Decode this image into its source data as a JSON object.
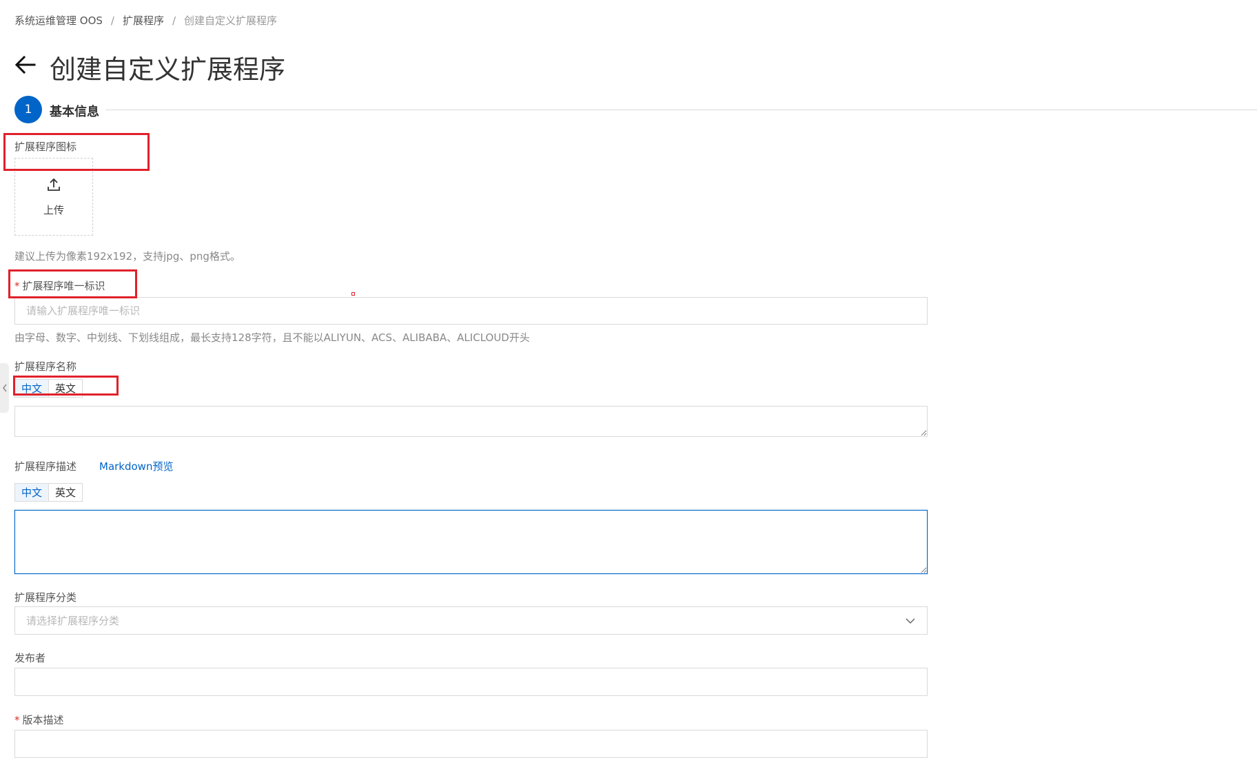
{
  "breadcrumb": {
    "items": [
      "系统运维管理 OOS",
      "扩展程序",
      "创建自定义扩展程序"
    ],
    "separator": "/"
  },
  "page": {
    "title": "创建自定义扩展程序"
  },
  "step": {
    "number": "1",
    "label": "基本信息"
  },
  "form": {
    "icon": {
      "label": "扩展程序图标",
      "upload_text": "上传",
      "hint": "建议上传为像素192x192，支持jpg、png格式。"
    },
    "identifier": {
      "required_mark": "*",
      "label": "扩展程序唯一标识",
      "placeholder": "请输入扩展程序唯一标识",
      "value": "",
      "hint": "由字母、数字、中划线、下划线组成，最长支持128字符，且不能以ALIYUN、ACS、ALIBABA、ALICLOUD开头"
    },
    "name": {
      "label": "扩展程序名称",
      "lang_tabs": [
        "中文",
        "英文"
      ],
      "active_lang": "中文",
      "value": ""
    },
    "description": {
      "label": "扩展程序描述",
      "preview_link": "Markdown预览",
      "lang_tabs": [
        "中文",
        "英文"
      ],
      "active_lang": "中文",
      "value": ""
    },
    "category": {
      "label": "扩展程序分类",
      "placeholder": "请选择扩展程序分类"
    },
    "publisher": {
      "label": "发布者",
      "value": ""
    },
    "version_desc": {
      "required_mark": "*",
      "label": "版本描述"
    }
  },
  "colors": {
    "primary": "#0064c8",
    "required": "#d93026",
    "annotation": "#e0202a",
    "border": "#d9d9d9"
  },
  "icons": {
    "back": "arrow-left-icon",
    "upload": "upload-icon",
    "select": "chevron-down-icon",
    "side": "chevron-left-icon"
  }
}
